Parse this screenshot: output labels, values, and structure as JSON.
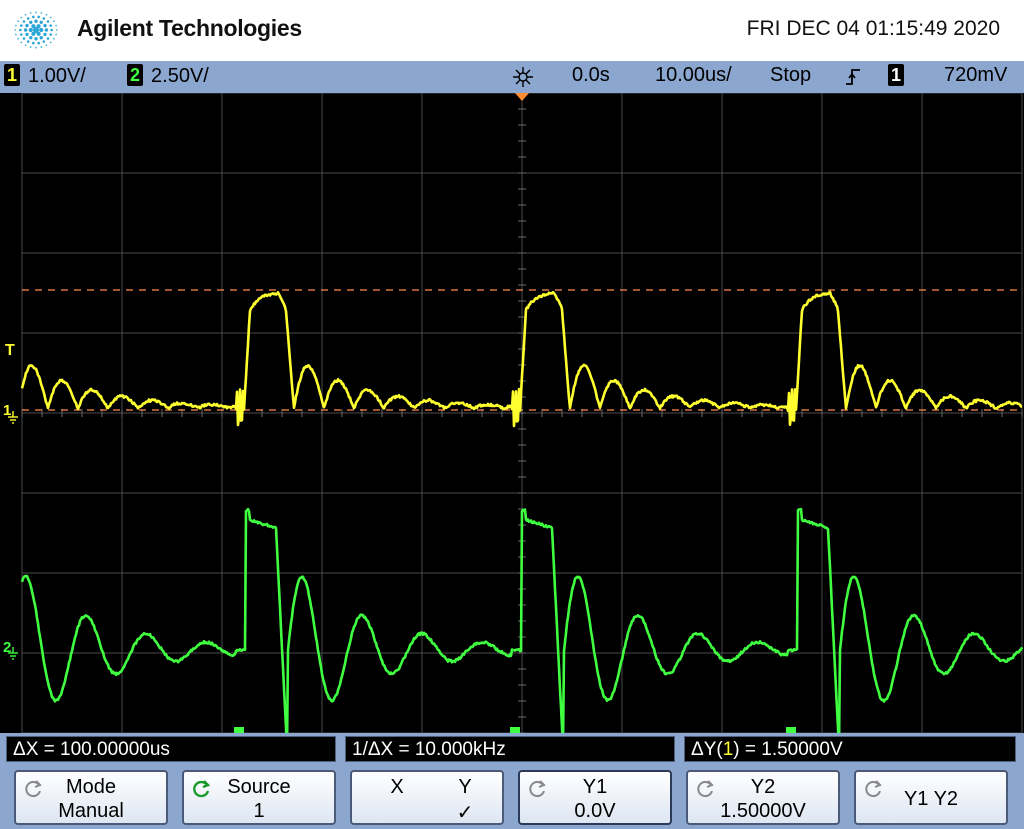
{
  "header": {
    "brand": "Agilent Technologies",
    "datetime": "FRI DEC 04 01:15:49 2020"
  },
  "status": {
    "ch1_num": "1",
    "ch1_scale": "1.00V/",
    "ch2_num": "2",
    "ch2_scale": "2.50V/",
    "delay": "0.0s",
    "timebase": "10.00us/",
    "run_state": "Stop",
    "trigger_source": "1",
    "trigger_level": "720mV"
  },
  "markers": {
    "trigger": "T",
    "ch1": "1",
    "ch2": "2"
  },
  "measurements": {
    "delta_x": "ΔX = 100.00000us",
    "inv_delta_x": "1/ΔX = 10.000kHz",
    "delta_y_prefix": "ΔY(",
    "delta_y_channel": "1",
    "delta_y_suffix": ") = 1.50000V"
  },
  "softkeys": [
    {
      "line1": "Mode",
      "line2": "Manual"
    },
    {
      "line1": "Source",
      "line2": "1"
    },
    {
      "line1": "X",
      "line1b": "Y",
      "line2": "✓"
    },
    {
      "line1": "Y1",
      "line2": "0.0V"
    },
    {
      "line1": "Y2",
      "line2": "1.50000V"
    },
    {
      "line1": "Y1 Y2",
      "line2": ""
    }
  ],
  "colors": {
    "ch1": "#ffff30",
    "ch2": "#40ff40",
    "cursor": "#ff8c50",
    "grid": "#505050",
    "bars": "#8ba7cf"
  }
}
